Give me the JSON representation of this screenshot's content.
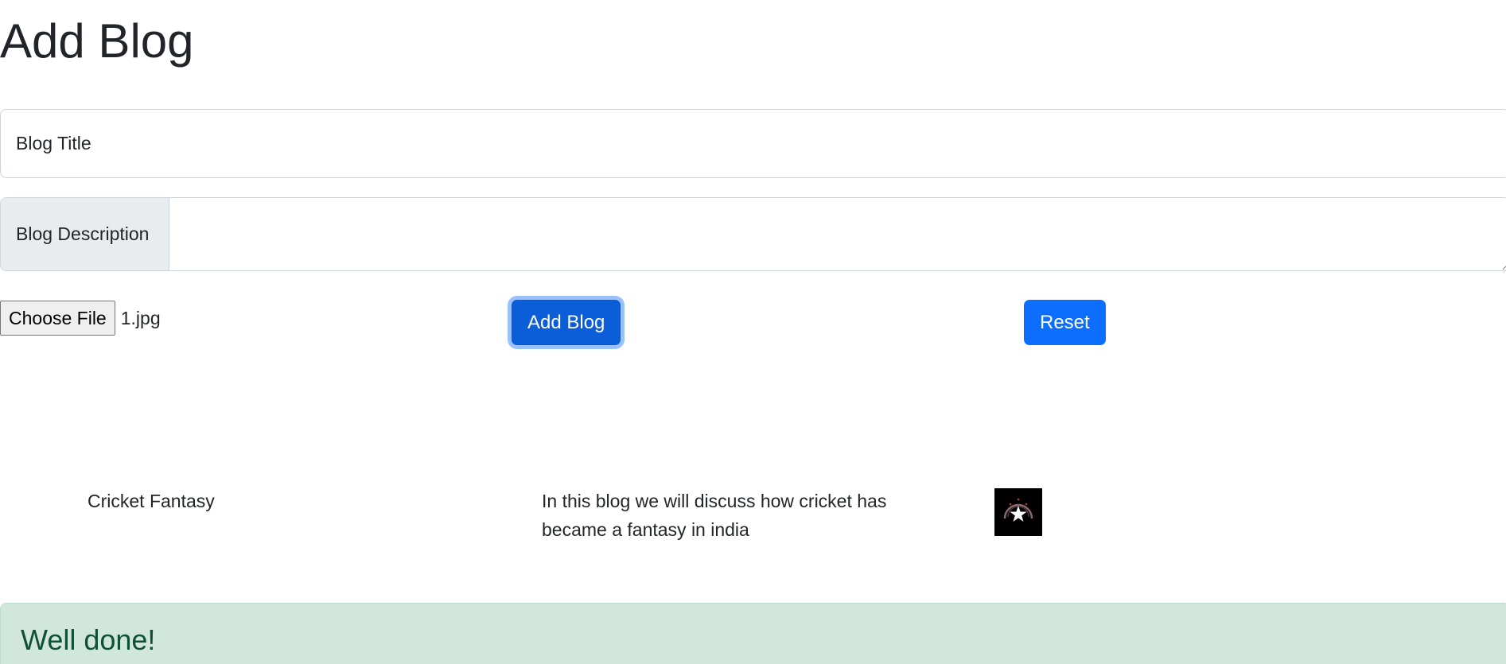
{
  "header": {
    "title": "Add Blog"
  },
  "form": {
    "title_placeholder": "Blog Title",
    "description_label": "Blog Description",
    "file_button_label": "Choose File",
    "file_name": "1.jpg",
    "submit_label": "Add Blog",
    "reset_label": "Reset"
  },
  "blogs": [
    {
      "title": "Cricket Fantasy",
      "description": "In this blog we will discuss how cricket has became a fantasy in india",
      "image_icon": "star-emblem-thumbnail"
    }
  ],
  "alert": {
    "heading": "Well done!"
  },
  "colors": {
    "primary": "#0d6efd",
    "primary_active": "#0b5ed7",
    "alert_bg": "#d1e7dd",
    "alert_text": "#0f5132",
    "addon_bg": "#e9ecef"
  }
}
